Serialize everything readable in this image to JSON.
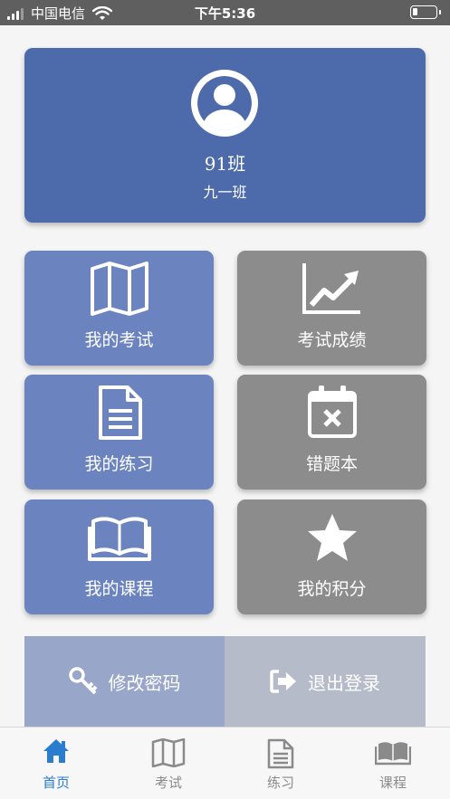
{
  "status_bar": {
    "carrier": "中国电信",
    "time": "下午5:36"
  },
  "profile": {
    "name": "91班",
    "class_name": "九一班"
  },
  "tiles": [
    {
      "label": "我的考试",
      "icon": "map-icon"
    },
    {
      "label": "考试成绩",
      "icon": "chart-line-icon"
    },
    {
      "label": "我的练习",
      "icon": "document-icon"
    },
    {
      "label": "错题本",
      "icon": "calendar-x-icon"
    },
    {
      "label": "我的课程",
      "icon": "book-icon"
    },
    {
      "label": "我的积分",
      "icon": "star-icon"
    }
  ],
  "actions": {
    "change_password": "修改密码",
    "logout": "退出登录"
  },
  "tabbar": [
    {
      "label": "首页",
      "icon": "home-icon",
      "active": true
    },
    {
      "label": "考试",
      "icon": "map-icon",
      "active": false
    },
    {
      "label": "练习",
      "icon": "document-icon",
      "active": false
    },
    {
      "label": "课程",
      "icon": "book-icon",
      "active": false
    }
  ],
  "colors": {
    "profile_bg": "#4d6aaa",
    "tile_blue": "#6b84c0",
    "tile_gray": "#8c8c8c",
    "action_left": "#97a6c9",
    "action_right": "#b5bbc9",
    "tab_active": "#2a7ccf",
    "tab_inactive": "#8a8a8a"
  }
}
